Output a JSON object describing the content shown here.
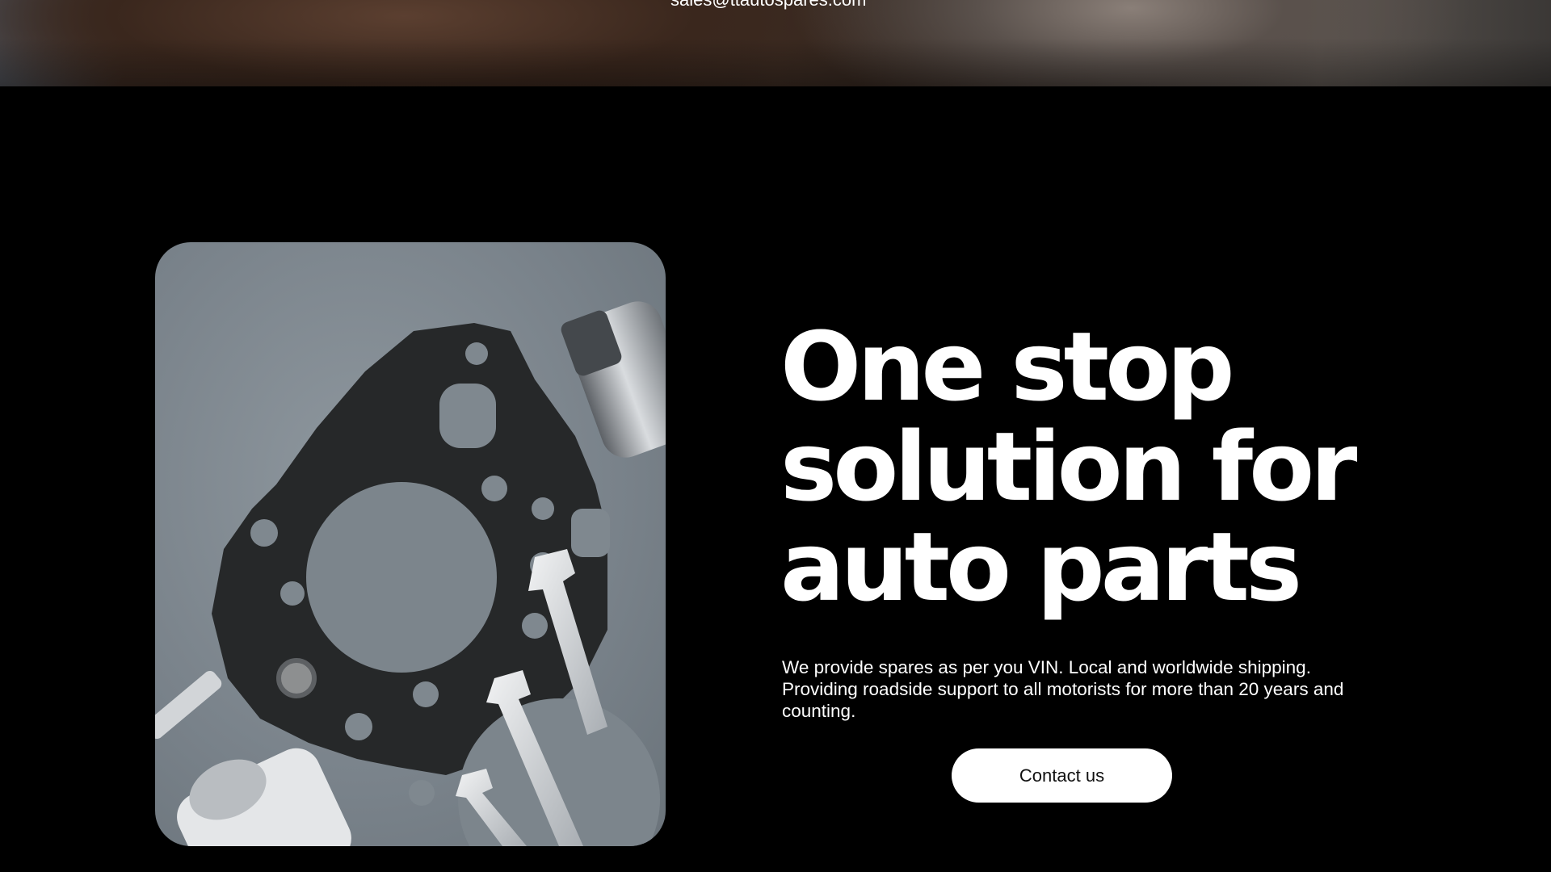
{
  "banner": {
    "email": "sales@ttautospares.com"
  },
  "hero": {
    "headline": "One stop solution for auto parts",
    "description": "We provide spares as per you VIN. Local and worldwide shipping. Providing roadside support to all motorists for more than 20 years and counting.",
    "cta_label": "Contact us"
  },
  "photo": {
    "subject": "auto-parts-gasket-wrenches-photo"
  },
  "colors": {
    "background": "#000000",
    "text": "#ffffff",
    "button_bg": "#ffffff",
    "button_text": "#111111"
  }
}
